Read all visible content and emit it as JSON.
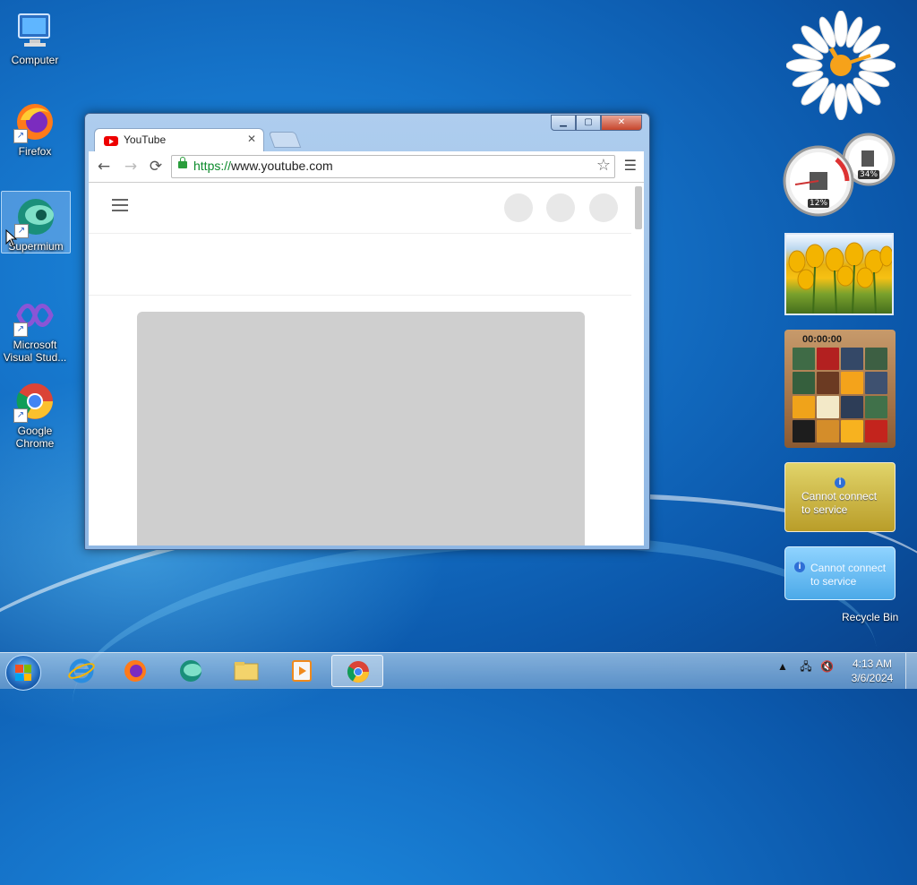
{
  "desktop": {
    "icons": [
      {
        "label": "Computer"
      },
      {
        "label": "Firefox"
      },
      {
        "label": "Supermium"
      },
      {
        "label": "Microsoft Visual Stud..."
      },
      {
        "label": "Google Chrome"
      }
    ],
    "recycle_bin": "Recycle Bin"
  },
  "browser": {
    "tab_title": "YouTube",
    "tab_close": "✕",
    "url_protocol": "https://",
    "url_rest": "www.youtube.com",
    "window_buttons": {
      "minimize": "▁",
      "maximize": "▢",
      "close": "✕"
    },
    "nav": {
      "back": "←",
      "forward": "→",
      "reload": "⟳",
      "star": "☆",
      "menu": "☰"
    }
  },
  "gadgets": {
    "cpu_percent": "12%",
    "memory_percent": "34%",
    "puzzle_time": "00:00:00",
    "weather_message": "Cannot connect to service",
    "feed_message": "Cannot connect to service"
  },
  "taskbar": {
    "time": "4:13 AM",
    "date": "3/6/2024"
  },
  "colors": {
    "accent": "#1573c9",
    "https_green": "#0b8a2b",
    "youtube_red": "#ee0000"
  }
}
